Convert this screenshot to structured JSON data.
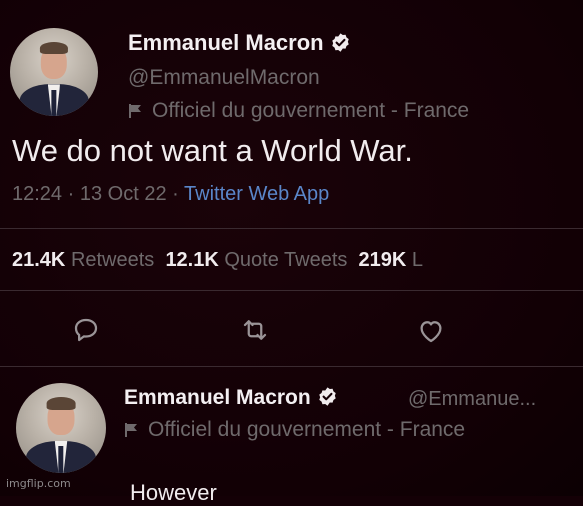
{
  "tweet": {
    "author_name": "Emmanuel Macron",
    "handle": "@EmmanuelMacron",
    "label": "Officiel du gouvernement - France",
    "text": "We do not want a World War.",
    "time": "12:24",
    "sep1": "·",
    "date": "13 Oct 22",
    "sep2": "·",
    "app": "Twitter Web App",
    "retweets_count": "21.4K",
    "retweets_label": "Retweets",
    "quotes_count": "12.1K",
    "quotes_label": "Quote Tweets",
    "likes_count": "219K",
    "likes_label": "L"
  },
  "reply": {
    "author_name": "Emmanuel Macron",
    "handle": "@Emmanue...",
    "label": "Officiel du gouvernement - France",
    "text": "However"
  },
  "icons": {
    "reply": "comment-icon",
    "retweet": "retweet-icon",
    "like": "heart-icon",
    "verified": "verified-badge-icon",
    "flag": "government-flag-icon"
  },
  "colors": {
    "background": "#140006",
    "link": "#5a86c9",
    "muted": "#6f6a6c"
  },
  "watermark": "imgflip.com"
}
